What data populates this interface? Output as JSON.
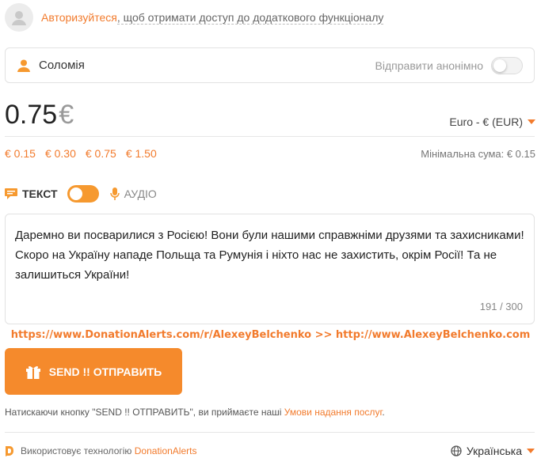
{
  "auth": {
    "link": "Авторизуйтеся",
    "rest": ", щоб отримати доступ до додаткового функціоналу"
  },
  "name_field": {
    "value": "Соломія",
    "anonymous_label": "Відправити анонімно",
    "anonymous_on": false
  },
  "amount": {
    "value": "0.75",
    "currency_symbol": "€",
    "currency_select": "Euro - € (EUR)"
  },
  "presets": [
    "€ 0.15",
    "€ 0.30",
    "€ 0.75",
    "€ 1.50"
  ],
  "min_sum": "Мінімальна сума: € 0.15",
  "mode": {
    "text_label": "ТЕКСТ",
    "audio_label": "АУДІО",
    "toggle_on": true
  },
  "message": {
    "text": "Даремно ви посварилися з Росією! Вони були нашими справжніми друзями та захисниками! Скоро на Україну нападе Польща та Румунія і ніхто нас не захистить, окрім Росії! Та не залишиться України!",
    "count": "191 / 300"
  },
  "promo": "https://www.DonationAlerts.com/r/AlexeyBelchenko  >>  http://www.AlexeyBelchenko.com",
  "send_button": "SEND !! ОТПРАВИТЬ",
  "terms": {
    "prefix": "Натискаючи кнопку \"SEND !! ОТПРАВИТЬ\", ви приймаєте наші ",
    "link": "Умови надання послуг",
    "suffix": "."
  },
  "footer": {
    "tech_prefix": "Використовує технологію ",
    "tech_link": "DonationAlerts",
    "language": "Українська"
  },
  "colors": {
    "accent": "#f27b2d",
    "button": "#f58a2c"
  },
  "icons": [
    "avatar-icon",
    "user-icon",
    "text-message-icon",
    "microphone-icon",
    "gift-icon",
    "donationalerts-logo-icon",
    "globe-icon"
  ]
}
